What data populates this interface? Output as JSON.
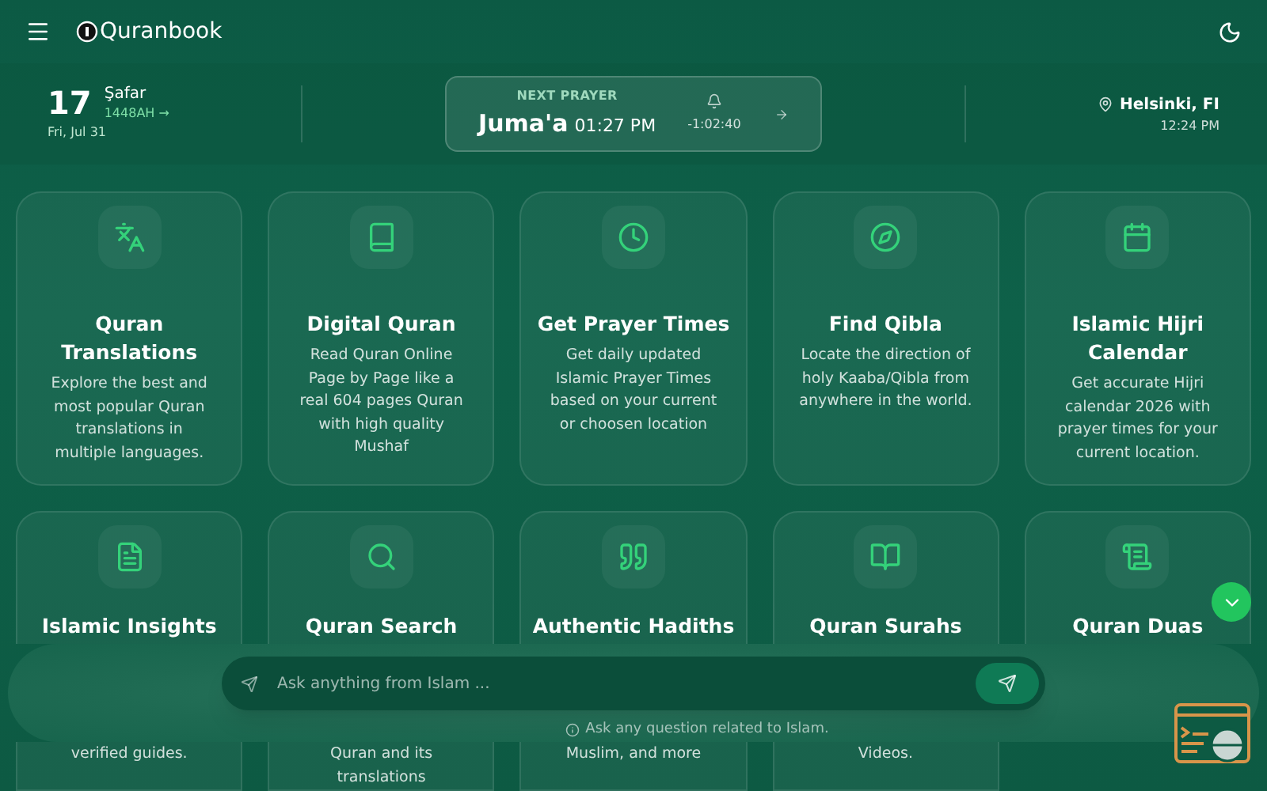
{
  "header": {
    "logo": "Quranbook"
  },
  "date": {
    "day": "17",
    "month": "Şafar",
    "year": "1448AH →",
    "weekday": "Fri, Jul 31"
  },
  "next_prayer": {
    "label": "NEXT PRAYER",
    "name": "Juma'a",
    "time": "01:27 PM",
    "countdown": "-1:02:40"
  },
  "location": {
    "city": "Helsinki, FI",
    "time": "12:24 PM"
  },
  "cards": [
    {
      "title": "Quran Translations",
      "description": "Explore the best and most popular Quran translations in multiple languages."
    },
    {
      "title": "Digital Quran",
      "description": "Read Quran Online Page by Page like a real 604 pages Quran with high quality Mushaf"
    },
    {
      "title": "Get Prayer Times",
      "description": "Get daily updated Islamic Prayer Times based on your current or choosen location"
    },
    {
      "title": "Find Qibla",
      "description": "Locate the direction of holy Kaaba/Qibla from anywhere in the world."
    },
    {
      "title": "Islamic Hijri Calendar",
      "description": "Get accurate Hijri calendar 2026 with prayer times for your current location."
    },
    {
      "title": "Islamic Insights",
      "description": "verified guides."
    },
    {
      "title": "Quran Search",
      "description": "Quran and its translations"
    },
    {
      "title": "Authentic Hadiths",
      "description": "Muslim, and more"
    },
    {
      "title": "Quran Surahs",
      "description": "Videos."
    },
    {
      "title": "Quran Duas"
    }
  ],
  "ask": {
    "placeholder": "Ask anything from Islam ...",
    "hint": "Ask any question related to Islam."
  }
}
